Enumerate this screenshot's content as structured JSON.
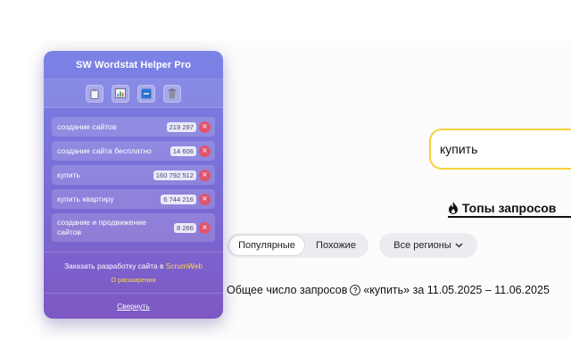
{
  "extension": {
    "title": "SW Wordstat Helper Pro",
    "toolbar_icons": [
      "clipboard-icon",
      "chart-icon",
      "minus-icon",
      "trash-icon"
    ],
    "keywords": [
      {
        "text": "создание сайтов",
        "count": "219 297"
      },
      {
        "text": "создание сайта бесплатно",
        "count": "14 606"
      },
      {
        "text": "купить",
        "count": "160 792 512"
      },
      {
        "text": "купить квартиру",
        "count": "6 744 216"
      },
      {
        "text": "создание и продвижение сайтов",
        "count": "8 266"
      }
    ],
    "delete_symbol": "×",
    "order_text": "Заказать разработку сайта в ",
    "order_link": "ScrumWeb",
    "about_link": "О расширении",
    "collapse_label": "Свернуть"
  },
  "search": {
    "query": "купить"
  },
  "tops": {
    "label": "Топы запросов"
  },
  "tabs": [
    {
      "label": "Популярные",
      "active": true
    },
    {
      "label": "Похожие",
      "active": false
    }
  ],
  "region": {
    "label": "Все регионы"
  },
  "total": {
    "prefix": "Общее число запросов",
    "suffix": "«купить» за 11.05.2025 – 11.06.2025"
  },
  "colors": {
    "accent_yellow": "#f5d13c",
    "popup_top": "#7b83e6",
    "popup_bottom": "#7d58c4",
    "delete_red": "#e0556e"
  }
}
